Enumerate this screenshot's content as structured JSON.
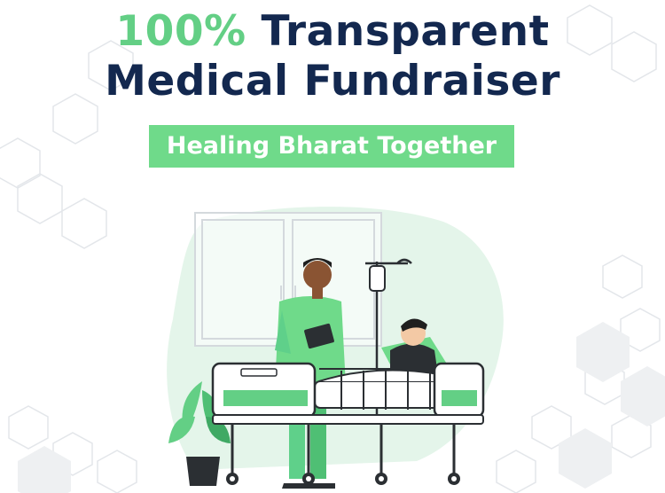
{
  "headline": {
    "accent": "100%",
    "line1_rest": " Transparent",
    "line2": "Medical Fundraiser"
  },
  "tagline": "Healing Bharat Together",
  "colors": {
    "accent_green": "#63cf85",
    "tagline_bg": "#6fda8a",
    "navy": "#13284f",
    "blob": "#e4f5ea"
  },
  "illustration": {
    "description_icons": [
      "hospital-bed-icon",
      "doctor-icon",
      "patient-icon",
      "iv-drip-icon",
      "potted-plant-icon",
      "window-icon"
    ]
  }
}
